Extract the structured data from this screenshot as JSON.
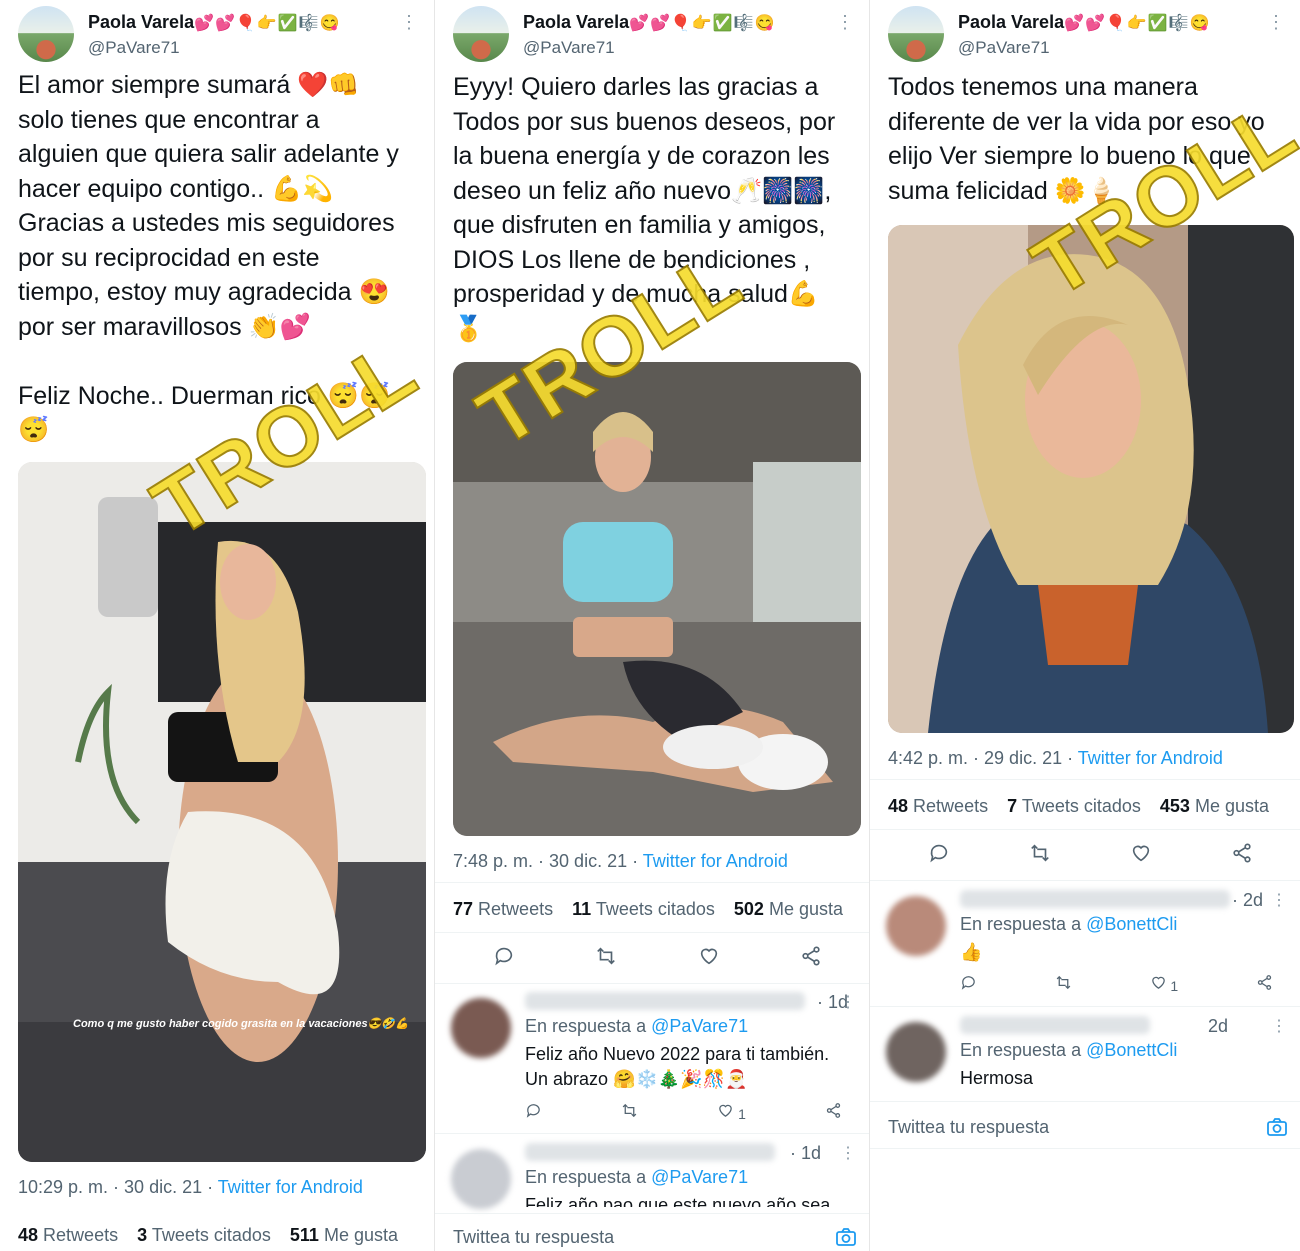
{
  "user": {
    "name": "Paola Varela",
    "name_emojis": "💕💕🎈👉✅🎼😋",
    "handle": "@PaVare71"
  },
  "watermark": "TROLL",
  "tweets": [
    {
      "text": "El amor siempre sumará ❤️👊\nsolo tienes que encontrar a\nalguien que quiera salir adelante y\nhacer equipo contigo.. 💪💫\nGracias a ustedes mis seguidores\npor su reciprocidad en este\ntiempo, estoy muy agradecida 😍\npor ser maravillosos 👏💕\n\nFeliz Noche.. Duerman rico 😴😴\n😴",
      "image_caption": "Como q me gusto haber cogido grasita en la vacaciones😎🤣💪",
      "time": "10:29 p. m. · 30 dic. 21 · ",
      "source": "Twitter for Android",
      "retweets": "48",
      "retweets_label": "Retweets",
      "quotes": "3",
      "quotes_label": "Tweets citados",
      "likes": "511",
      "likes_label": "Me gusta"
    },
    {
      "text": "Eyyy! Quiero darles las gracias a\nTodos por sus buenos deseos, por\nla buena energía y de corazon les\ndeseo un feliz año nuevo🥂🎆🎆,\nque disfruten en familia y amigos,\nDIOS Los llene de bendiciones ,\nprosperidad y de mucha salud💪\n🥇",
      "time": "7:48 p. m. · 30 dic. 21 · ",
      "source": "Twitter for Android",
      "retweets": "77",
      "retweets_label": "Retweets",
      "quotes": "11",
      "quotes_label": "Tweets citados",
      "likes": "502",
      "likes_label": "Me gusta",
      "replies": [
        {
          "time": "· 1d",
          "reply_to": "En respuesta a ",
          "mention": "@PaVare71",
          "text": "Feliz año Nuevo 2022 para ti también.\nUn abrazo 🤗❄️🎄🎉🎊🎅",
          "likes": "1"
        },
        {
          "time": "· 1d",
          "reply_to": "En respuesta a ",
          "mention": "@PaVare71",
          "text": "Feliz año pao que este nuevo año sea de"
        }
      ],
      "composer": "Twittea tu respuesta"
    },
    {
      "text": "Todos tenemos una manera\ndiferente de ver la vida por eso yo\nelijo Ver siempre lo bueno lo que\nsuma felicidad 🌼🍦",
      "time": "4:42 p. m. · 29 dic. 21 · ",
      "source": "Twitter for Android",
      "retweets": "48",
      "retweets_label": "Retweets",
      "quotes": "7",
      "quotes_label": "Tweets citados",
      "likes": "453",
      "likes_label": "Me gusta",
      "replies": [
        {
          "time": "· 2d",
          "reply_to": "En respuesta a ",
          "mention": "@BonettCli",
          "text": "👍",
          "likes": "1"
        },
        {
          "time": "2d",
          "reply_to": "En respuesta a ",
          "mention": "@BonettCli",
          "text": "Hermosa"
        }
      ],
      "composer": "Twittea tu respuesta"
    }
  ],
  "first_tweet_stats_label": {
    "retweets": "48",
    "quotes": "3",
    "likes": "511"
  },
  "colors": {
    "link": "#1d9bf0",
    "secondary": "#536471",
    "watermark": "#f6dc2e"
  },
  "icons": [
    "reply-icon",
    "retweet-icon",
    "like-icon",
    "share-icon",
    "camera-icon",
    "more-icon"
  ]
}
